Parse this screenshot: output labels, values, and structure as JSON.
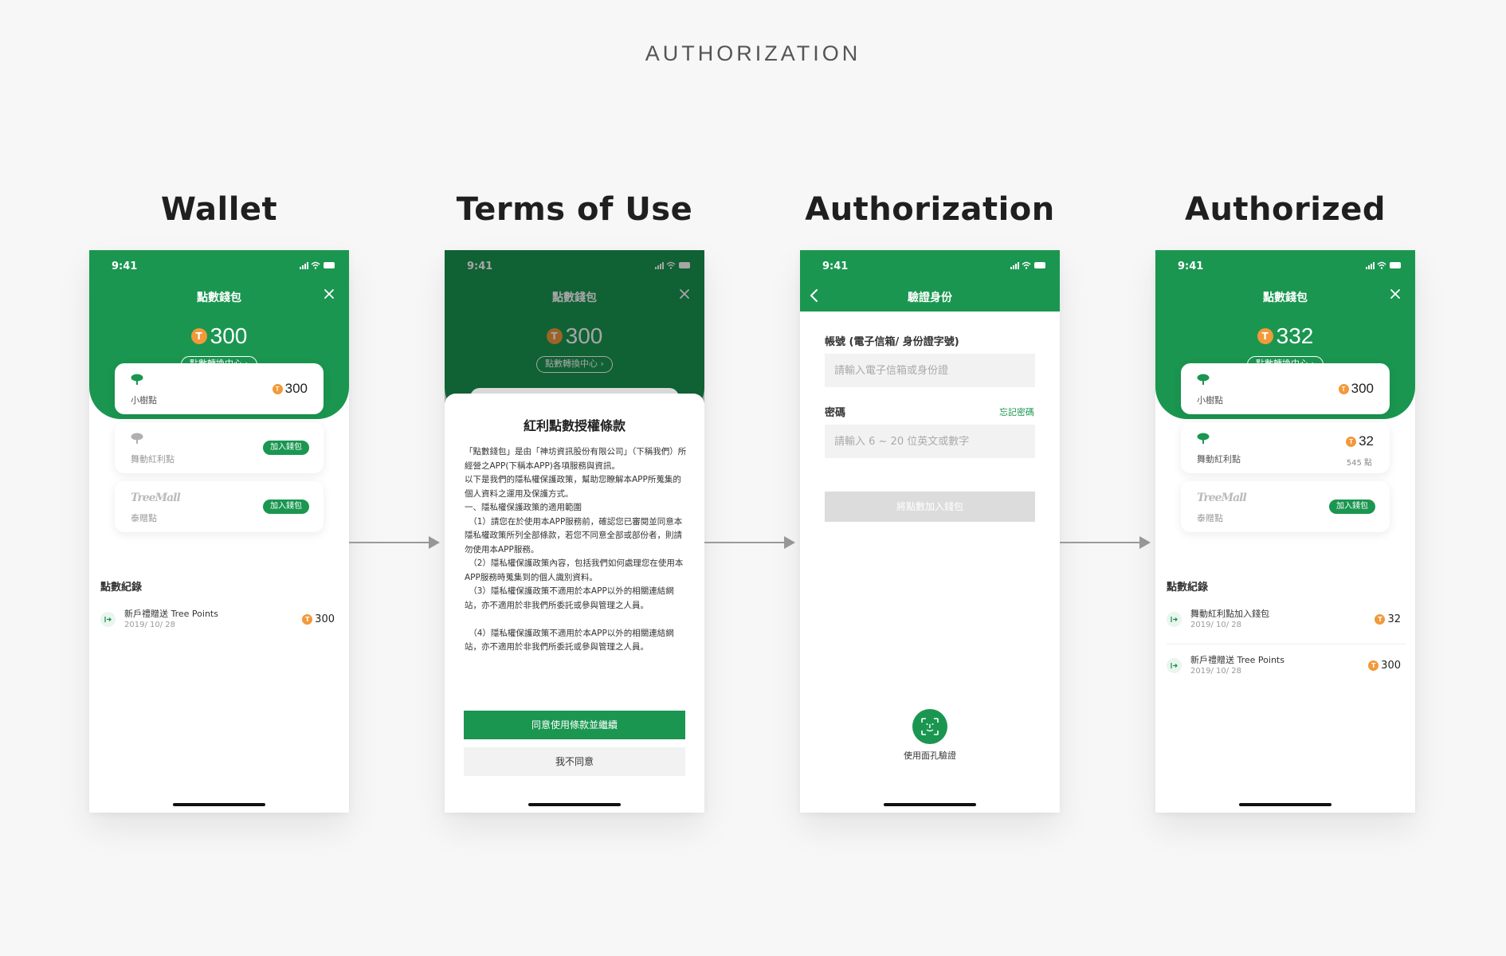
{
  "page_title": "AUTHORIZATION",
  "status_time": "9:41",
  "brand_color": "#1a9650",
  "coin_color": "#f2993a",
  "coin_glyph": "T",
  "columns": [
    {
      "title": "Wallet"
    },
    {
      "title": "Terms of Use"
    },
    {
      "title": "Authorization"
    },
    {
      "title": "Authorized"
    }
  ],
  "wallet": {
    "header_title": "點數錢包",
    "balance": "300",
    "transfer_label": "點數轉換中心 ›",
    "cards": [
      {
        "label": "小樹點",
        "points": "300"
      },
      {
        "label": "舞動紅利點",
        "add_label": "加入錢包"
      },
      {
        "logo": "TreeMall",
        "label": "泰贈點",
        "add_label": "加入錢包"
      }
    ],
    "records_title": "點數紀錄",
    "records": [
      {
        "name": "新戶禮贈送 Tree Points",
        "date": "2019/ 10/ 28",
        "points": "300"
      }
    ]
  },
  "terms": {
    "header_title": "點數錢包",
    "balance": "300",
    "transfer_label": "點數轉換中心 ›",
    "sheet_title": "紅利點數授權條款",
    "paragraphs": [
      "「點數錢包」是由「神坊資訊股份有限公司」（下稱我們）所經營之APP(下稱本APP)各項服務與資訊。",
      "以下是我們的隱私權保護政策，幫助您瞭解本APP所蒐集的個人資料之運用及保護方式。",
      "一、隱私權保護政策的適用範圍",
      "　（1）請您在於使用本APP服務前，確認您已審閱並同意本隱私權政策所列全部條款，若您不同意全部或部份者，則請勿使用本APP服務。",
      "　（2）隱私權保護政策內容，包括我們如何處理您在使用本APP服務時蒐集到的個人識別資料。",
      "　（3）隱私權保護政策不適用於本APP以外的相關連結網站，亦不適用於非我們所委託或參與管理之人員。",
      " ",
      "　（4）隱私權保護政策不適用於本APP以外的相關連結網站，亦不適用於非我們所委託或參與管理之人員。"
    ],
    "agree_label": "同意使用條款並繼續",
    "disagree_label": "我不同意"
  },
  "auth": {
    "header_title": "驗證身份",
    "account_label": "帳號 (電子信箱/ 身份證字號)",
    "account_placeholder": "請輸入電子信箱或身份證",
    "password_label": "密碼",
    "forgot_label": "忘記密碼",
    "password_placeholder": "請輸入 6 ~ 20 位英文或數字",
    "submit_label": "將點數加入錢包",
    "face_label": "使用面孔驗證"
  },
  "authorized": {
    "header_title": "點數錢包",
    "balance": "332",
    "transfer_label": "點數轉換中心 ›",
    "cards": [
      {
        "label": "小樹點",
        "points": "300"
      },
      {
        "label": "舞動紅利點",
        "points": "32",
        "sub": "545 點"
      },
      {
        "logo": "TreeMall",
        "label": "泰贈點",
        "add_label": "加入錢包"
      }
    ],
    "records_title": "點數紀錄",
    "records": [
      {
        "name": "舞動紅利點加入錢包",
        "date": "2019/ 10/ 28",
        "points": "32"
      },
      {
        "name": "新戶禮贈送 Tree Points",
        "date": "2019/ 10/ 28",
        "points": "300"
      }
    ]
  }
}
